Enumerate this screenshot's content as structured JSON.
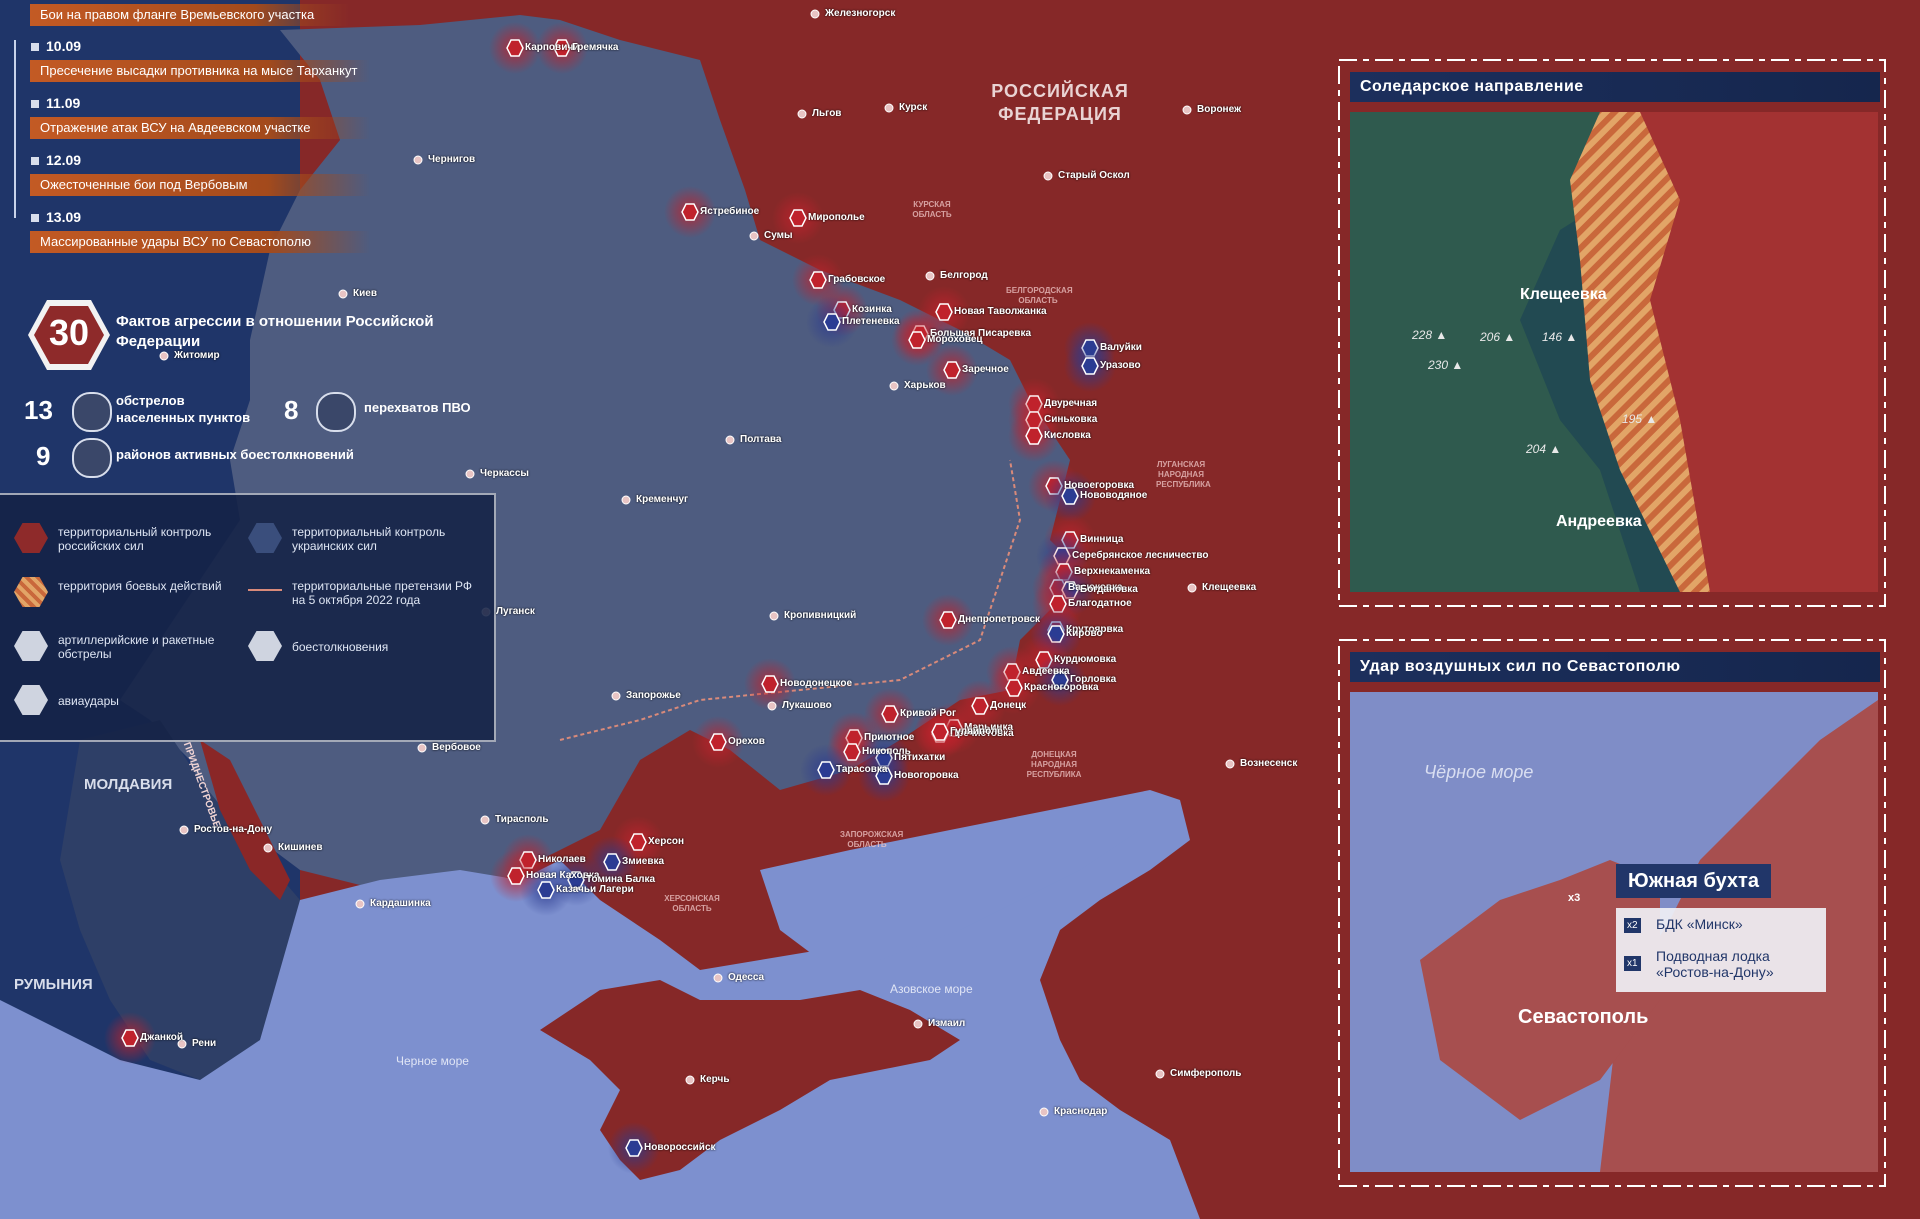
{
  "timeline": {
    "top_event": "Бои на правом фланге Времьевского участка",
    "items": [
      {
        "date": "10.09",
        "event": "Пресечение высадки противника на мысе Тарханкут"
      },
      {
        "date": "11.09",
        "event": "Отражение атак ВСУ на Авдеевском участке"
      },
      {
        "date": "12.09",
        "event": "Ожесточенные бои под Вербовым"
      },
      {
        "date": "13.09",
        "event": "Массированные удары ВСУ по Севастополю"
      }
    ]
  },
  "stats": {
    "total": "30",
    "total_label": "Фактов агрессии в отношении Российской Федерации",
    "shelling_count": "13",
    "shelling_label": "обстрелов населенных пунктов",
    "pvo_count": "8",
    "pvo_label": "перехватов ПВО",
    "clash_count": "9",
    "clash_label": "районов активных боестолкновений"
  },
  "legend": {
    "ru_control": "территориальный контроль российских сил",
    "ua_control": "территориальный контроль украинских сил",
    "combat_zone": "территория боевых действий",
    "claims": "территориальные претензии РФ на 5 октября 2022 года",
    "artillery": "артиллерийские и ракетные обстрелы",
    "clashes": "боестолкновения",
    "airstrikes": "авиаудары"
  },
  "country_labels": [
    "РОССИЙСКАЯ ФЕДЕРАЦИЯ",
    "МОЛДАВИЯ",
    "РУМЫНИЯ",
    "ПРИДНЕСТРОВЬЕ"
  ],
  "region_labels": [
    "КУРСКАЯ ОБЛАСТЬ",
    "БЕЛГОРОДСКАЯ ОБЛАСТЬ",
    "ЛУГАНСКАЯ НАРОДНАЯ РЕСПУБЛИКА",
    "ДОНЕЦКАЯ НАРОДНАЯ РЕСПУБЛИКА",
    "ЗАПОРОЖСКАЯ ОБЛАСТЬ",
    "ХЕРСОНСКАЯ ОБЛАСТЬ"
  ],
  "sea_labels": [
    "Черное море",
    "Азовское море"
  ],
  "cities": [
    "Железногорск",
    "Карповичи",
    "Гремячка",
    "Чернигов",
    "Льгов",
    "Курск",
    "Воронеж",
    "Старый Оскол",
    "Ястребиное",
    "Мирополье",
    "Сумы",
    "Грабовское",
    "Белгород",
    "Новая Таволжанка",
    "Козинка",
    "Большая Писаревка",
    "Плетеневка",
    "Мороховец",
    "Валуйки",
    "Уразово",
    "Заречное",
    "Харьков",
    "Двуречная",
    "Синьковка",
    "Кисловка",
    "Киев",
    "Житомир",
    "Черкассы",
    "Полтава",
    "Кременчуг",
    "Новоегоровка",
    "Нововодяное",
    "Винница",
    "Серебрянское лесничество",
    "Верхнекаменка",
    "Васюковка",
    "Богдановка",
    "Благодатное",
    "Клещеевка",
    "Луганск",
    "Кропивницкий",
    "Днепропетровск",
    "Крутоярвка",
    "Кирово",
    "Курдюмовка",
    "Горловка",
    "Авдеевка",
    "Красногоровка",
    "Донецк",
    "Марьинка",
    "Пречистовка",
    "Новодонецкое",
    "Лукашово",
    "Запорожье",
    "Кривой Рог",
    "Гуляйполе",
    "Приютное",
    "Орехов",
    "Никополь",
    "Пятихатки",
    "Тарасовка",
    "Новогоровка",
    "Вербовое",
    "Вознесенск",
    "Ростов-на-Дону",
    "Кишинев",
    "Тирасполь",
    "Николаев",
    "Херсон",
    "Змиевка",
    "Новая Каховка",
    "Томина Балка",
    "Казачьи Лагери",
    "Кардашинка",
    "Одесса",
    "Джанкой",
    "Рени",
    "Измаил",
    "Керчь",
    "Симферополь",
    "Краснодар",
    "Новороссийск",
    "Севастополь"
  ],
  "inset_soledar": {
    "title": "Соледарское направление",
    "places": [
      "Клещеевка",
      "Андреевка"
    ],
    "heights": [
      "228",
      "206",
      "146",
      "230",
      "195",
      "204"
    ]
  },
  "inset_sevastopol": {
    "title": "Удар воздушных сил по Севастополю",
    "sea": "Чёрное море",
    "bay": "Южная бухта",
    "multiplier": "x3",
    "targets": [
      {
        "count": "x2",
        "name": "БДК «Минск»"
      },
      {
        "count": "x1",
        "name": "Подводная лодка «Ростов-на-Дону»"
      }
    ],
    "city": "Севастополь"
  },
  "colors": {
    "ru": "#8e2a2a",
    "ua": "#3a4e7c",
    "sea": "#7d90cf",
    "accent": "#c35a24"
  }
}
